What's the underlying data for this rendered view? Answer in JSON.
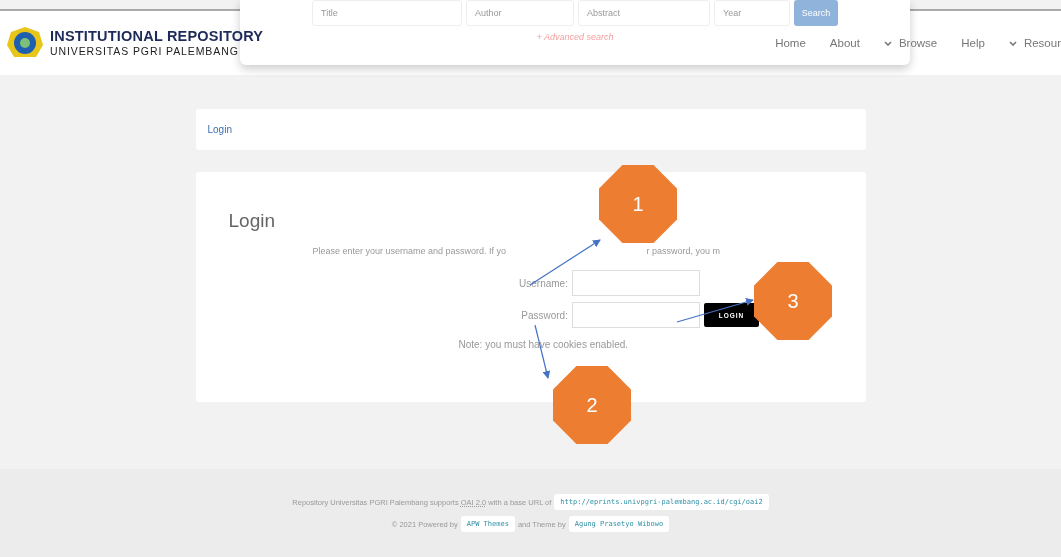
{
  "header": {
    "title": "INSTITUTIONAL REPOSITORY",
    "subtitle": "UNIVERSITAS PGRI PALEMBANG"
  },
  "search_panel": {
    "fields": [
      {
        "placeholder": "Title"
      },
      {
        "placeholder": "Author"
      },
      {
        "placeholder": "Abstract"
      },
      {
        "placeholder": "Year"
      }
    ],
    "button": "Search",
    "advanced_link": "+ Advanced search"
  },
  "nav": [
    {
      "label": "Home",
      "dropdown": false
    },
    {
      "label": "About",
      "dropdown": false
    },
    {
      "label": "Browse",
      "dropdown": true
    },
    {
      "label": "Help",
      "dropdown": false
    },
    {
      "label": "Resour",
      "dropdown": true
    }
  ],
  "breadcrumb": "Login",
  "login": {
    "heading": "Login",
    "intro_parts": [
      "Please enter your username and password. If yo",
      "r password, you m"
    ],
    "username_label": "Username:",
    "password_label": "Password:",
    "button": "LOGIN",
    "note": "Note: you must have cookies enabled."
  },
  "callouts": [
    {
      "number": "1"
    },
    {
      "number": "2"
    },
    {
      "number": "3"
    }
  ],
  "footer": {
    "line1_parts": [
      "Repository Universitas PGRI Palembang supports ",
      "OAI 2.0",
      " with a base URL of "
    ],
    "base_url": "http://eprints.univpgri-palembang.ac.id/cgi/oai2",
    "line2_parts": [
      "© 2021 Powered by ",
      "and Theme by "
    ],
    "powered_by": "APW Themes",
    "theme_by": "Agung Prasetyo Wibowo"
  }
}
